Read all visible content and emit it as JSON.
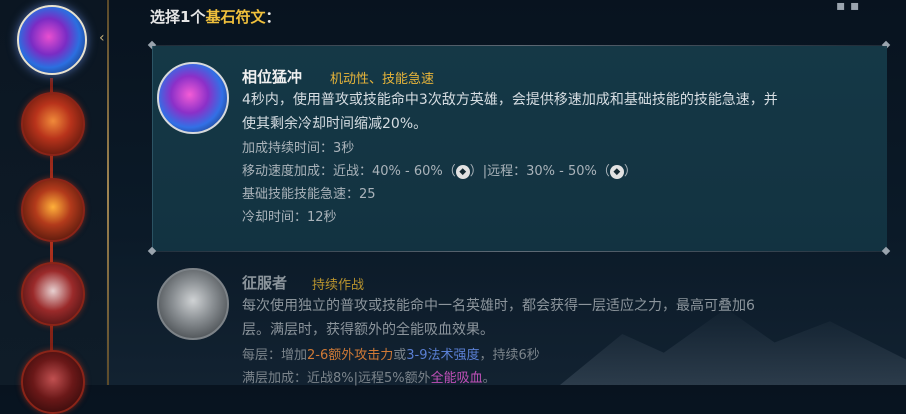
{
  "header": {
    "prefix": "选择1个",
    "highlight": "基石符文",
    "suffix": "："
  },
  "colors": {
    "accent_gold": "#f0c03c",
    "tag_gold": "#e8b53a",
    "attack_orange": "#d07a36",
    "magic_blue": "#5a7fd4",
    "omnivamp_pink": "#c050b8"
  },
  "rail": {
    "runes": [
      {
        "name": "phase-rush-rune-icon",
        "selected": true
      },
      {
        "name": "fire-rune-icon",
        "selected": false
      },
      {
        "name": "sword-rune-icon",
        "selected": false
      },
      {
        "name": "eye-rune-icon",
        "selected": false
      },
      {
        "name": "red-rune-icon",
        "selected": false
      }
    ]
  },
  "card1": {
    "title": "相位猛冲",
    "tag": "机动性、技能急速",
    "desc": "4秒内，使用普攻或技能命中3次敌方英雄，会提供移速加成和基础技能的技能急速，并使其剩余冷却时间缩减20%。",
    "stat1": "加成持续时间：3秒",
    "stat2_a": "移动速度加成：近战：40% - 60%（",
    "stat2_b": "）|远程：30% - 50%（",
    "stat2_c": "）",
    "stat3": "基础技能技能急速：25",
    "stat4": "冷却时间：12秒"
  },
  "card2": {
    "title": "征服者",
    "tag": "持续作战",
    "desc": "每次使用独立的普攻或技能命中一名英雄时，都会获得一层适应之力，最高可叠加6层。满层时，获得额外的全能吸血效果。",
    "line1_a": "每层：增加",
    "line1_b": "2-6额外攻击力",
    "line1_c": "或",
    "line1_d": "3-9法术强度",
    "line1_e": "，持续6秒",
    "line2_a": "满层加成：近战8%|远程5%额外",
    "line2_b": "全能吸血",
    "line2_c": "。"
  }
}
